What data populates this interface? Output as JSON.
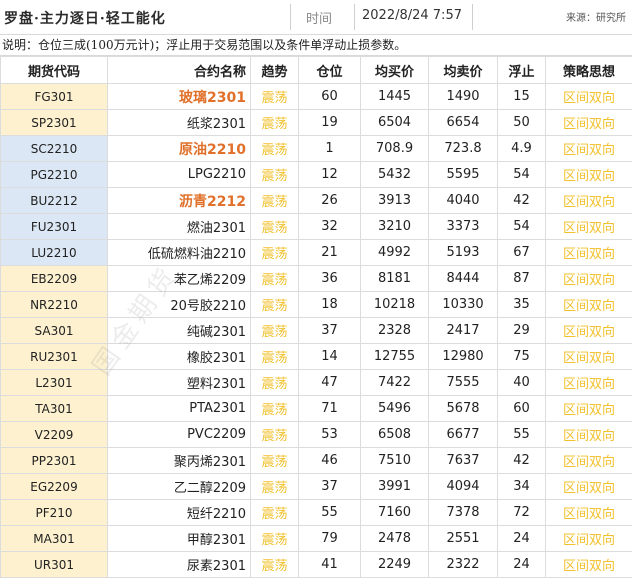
{
  "header": {
    "title": "罗盘·主力逐日·轻工能化",
    "time_label": "时间",
    "time_value": "2022/8/24 7:57",
    "source": "来源：研究所"
  },
  "note": "说明：仓位三成(100万元计)；浮止用于交易范围以及条件单浮动止损参数。",
  "columns": [
    "期货代码",
    "合约名称",
    "趋势",
    "仓位",
    "均买价",
    "均卖价",
    "浮止",
    "策略思想"
  ],
  "colors": {
    "code_yellow_bg": "#fdf1cf",
    "code_blue_bg": "#dbe7f4",
    "highlight_name": "#e0702a",
    "trend_text": "#f2c12e"
  },
  "rows": [
    {
      "code": "FG301",
      "name": "玻璃2301",
      "trend": "震荡",
      "position": "60",
      "buy": "1445",
      "sell": "1490",
      "stop": "15",
      "strategy": "区间双向",
      "group": "y",
      "hl": true
    },
    {
      "code": "SP2301",
      "name": "纸浆2301",
      "trend": "震荡",
      "position": "19",
      "buy": "6504",
      "sell": "6654",
      "stop": "50",
      "strategy": "区间双向",
      "group": "y",
      "hl": false
    },
    {
      "code": "SC2210",
      "name": "原油2210",
      "trend": "震荡",
      "position": "1",
      "buy": "708.9",
      "sell": "723.8",
      "stop": "4.9",
      "strategy": "区间双向",
      "group": "b",
      "hl": true
    },
    {
      "code": "PG2210",
      "name": "LPG2210",
      "trend": "震荡",
      "position": "12",
      "buy": "5432",
      "sell": "5595",
      "stop": "54",
      "strategy": "区间双向",
      "group": "b",
      "hl": false
    },
    {
      "code": "BU2212",
      "name": "沥青2212",
      "trend": "震荡",
      "position": "26",
      "buy": "3913",
      "sell": "4040",
      "stop": "42",
      "strategy": "区间双向",
      "group": "b",
      "hl": true
    },
    {
      "code": "FU2301",
      "name": "燃油2301",
      "trend": "震荡",
      "position": "32",
      "buy": "3210",
      "sell": "3373",
      "stop": "54",
      "strategy": "区间双向",
      "group": "b",
      "hl": false
    },
    {
      "code": "LU2210",
      "name": "低硫燃料油2210",
      "trend": "震荡",
      "position": "21",
      "buy": "4992",
      "sell": "5193",
      "stop": "67",
      "strategy": "区间双向",
      "group": "b",
      "hl": false
    },
    {
      "code": "EB2209",
      "name": "苯乙烯2209",
      "trend": "震荡",
      "position": "36",
      "buy": "8181",
      "sell": "8444",
      "stop": "87",
      "strategy": "区间双向",
      "group": "y",
      "hl": false
    },
    {
      "code": "NR2210",
      "name": "20号胶2210",
      "trend": "震荡",
      "position": "18",
      "buy": "10218",
      "sell": "10330",
      "stop": "35",
      "strategy": "区间双向",
      "group": "y",
      "hl": false
    },
    {
      "code": "SA301",
      "name": "纯碱2301",
      "trend": "震荡",
      "position": "37",
      "buy": "2328",
      "sell": "2417",
      "stop": "29",
      "strategy": "区间双向",
      "group": "y",
      "hl": false
    },
    {
      "code": "RU2301",
      "name": "橡胶2301",
      "trend": "震荡",
      "position": "14",
      "buy": "12755",
      "sell": "12980",
      "stop": "75",
      "strategy": "区间双向",
      "group": "y",
      "hl": false
    },
    {
      "code": "L2301",
      "name": "塑料2301",
      "trend": "震荡",
      "position": "47",
      "buy": "7422",
      "sell": "7555",
      "stop": "40",
      "strategy": "区间双向",
      "group": "y",
      "hl": false
    },
    {
      "code": "TA301",
      "name": "PTA2301",
      "trend": "震荡",
      "position": "71",
      "buy": "5496",
      "sell": "5678",
      "stop": "60",
      "strategy": "区间双向",
      "group": "y",
      "hl": false
    },
    {
      "code": "V2209",
      "name": "PVC2209",
      "trend": "震荡",
      "position": "53",
      "buy": "6508",
      "sell": "6677",
      "stop": "55",
      "strategy": "区间双向",
      "group": "y",
      "hl": false
    },
    {
      "code": "PP2301",
      "name": "聚丙烯2301",
      "trend": "震荡",
      "position": "46",
      "buy": "7510",
      "sell": "7637",
      "stop": "42",
      "strategy": "区间双向",
      "group": "y",
      "hl": false
    },
    {
      "code": "EG2209",
      "name": "乙二醇2209",
      "trend": "震荡",
      "position": "37",
      "buy": "3991",
      "sell": "4094",
      "stop": "34",
      "strategy": "区间双向",
      "group": "y",
      "hl": false
    },
    {
      "code": "PF210",
      "name": "短纤2210",
      "trend": "震荡",
      "position": "55",
      "buy": "7160",
      "sell": "7378",
      "stop": "72",
      "strategy": "区间双向",
      "group": "y",
      "hl": false
    },
    {
      "code": "MA301",
      "name": "甲醇2301",
      "trend": "震荡",
      "position": "79",
      "buy": "2478",
      "sell": "2551",
      "stop": "24",
      "strategy": "区间双向",
      "group": "y",
      "hl": false
    },
    {
      "code": "UR301",
      "name": "尿素2301",
      "trend": "震荡",
      "position": "41",
      "buy": "2249",
      "sell": "2322",
      "stop": "24",
      "strategy": "区间双向",
      "group": "y",
      "hl": false
    }
  ],
  "watermark": "国金期货"
}
